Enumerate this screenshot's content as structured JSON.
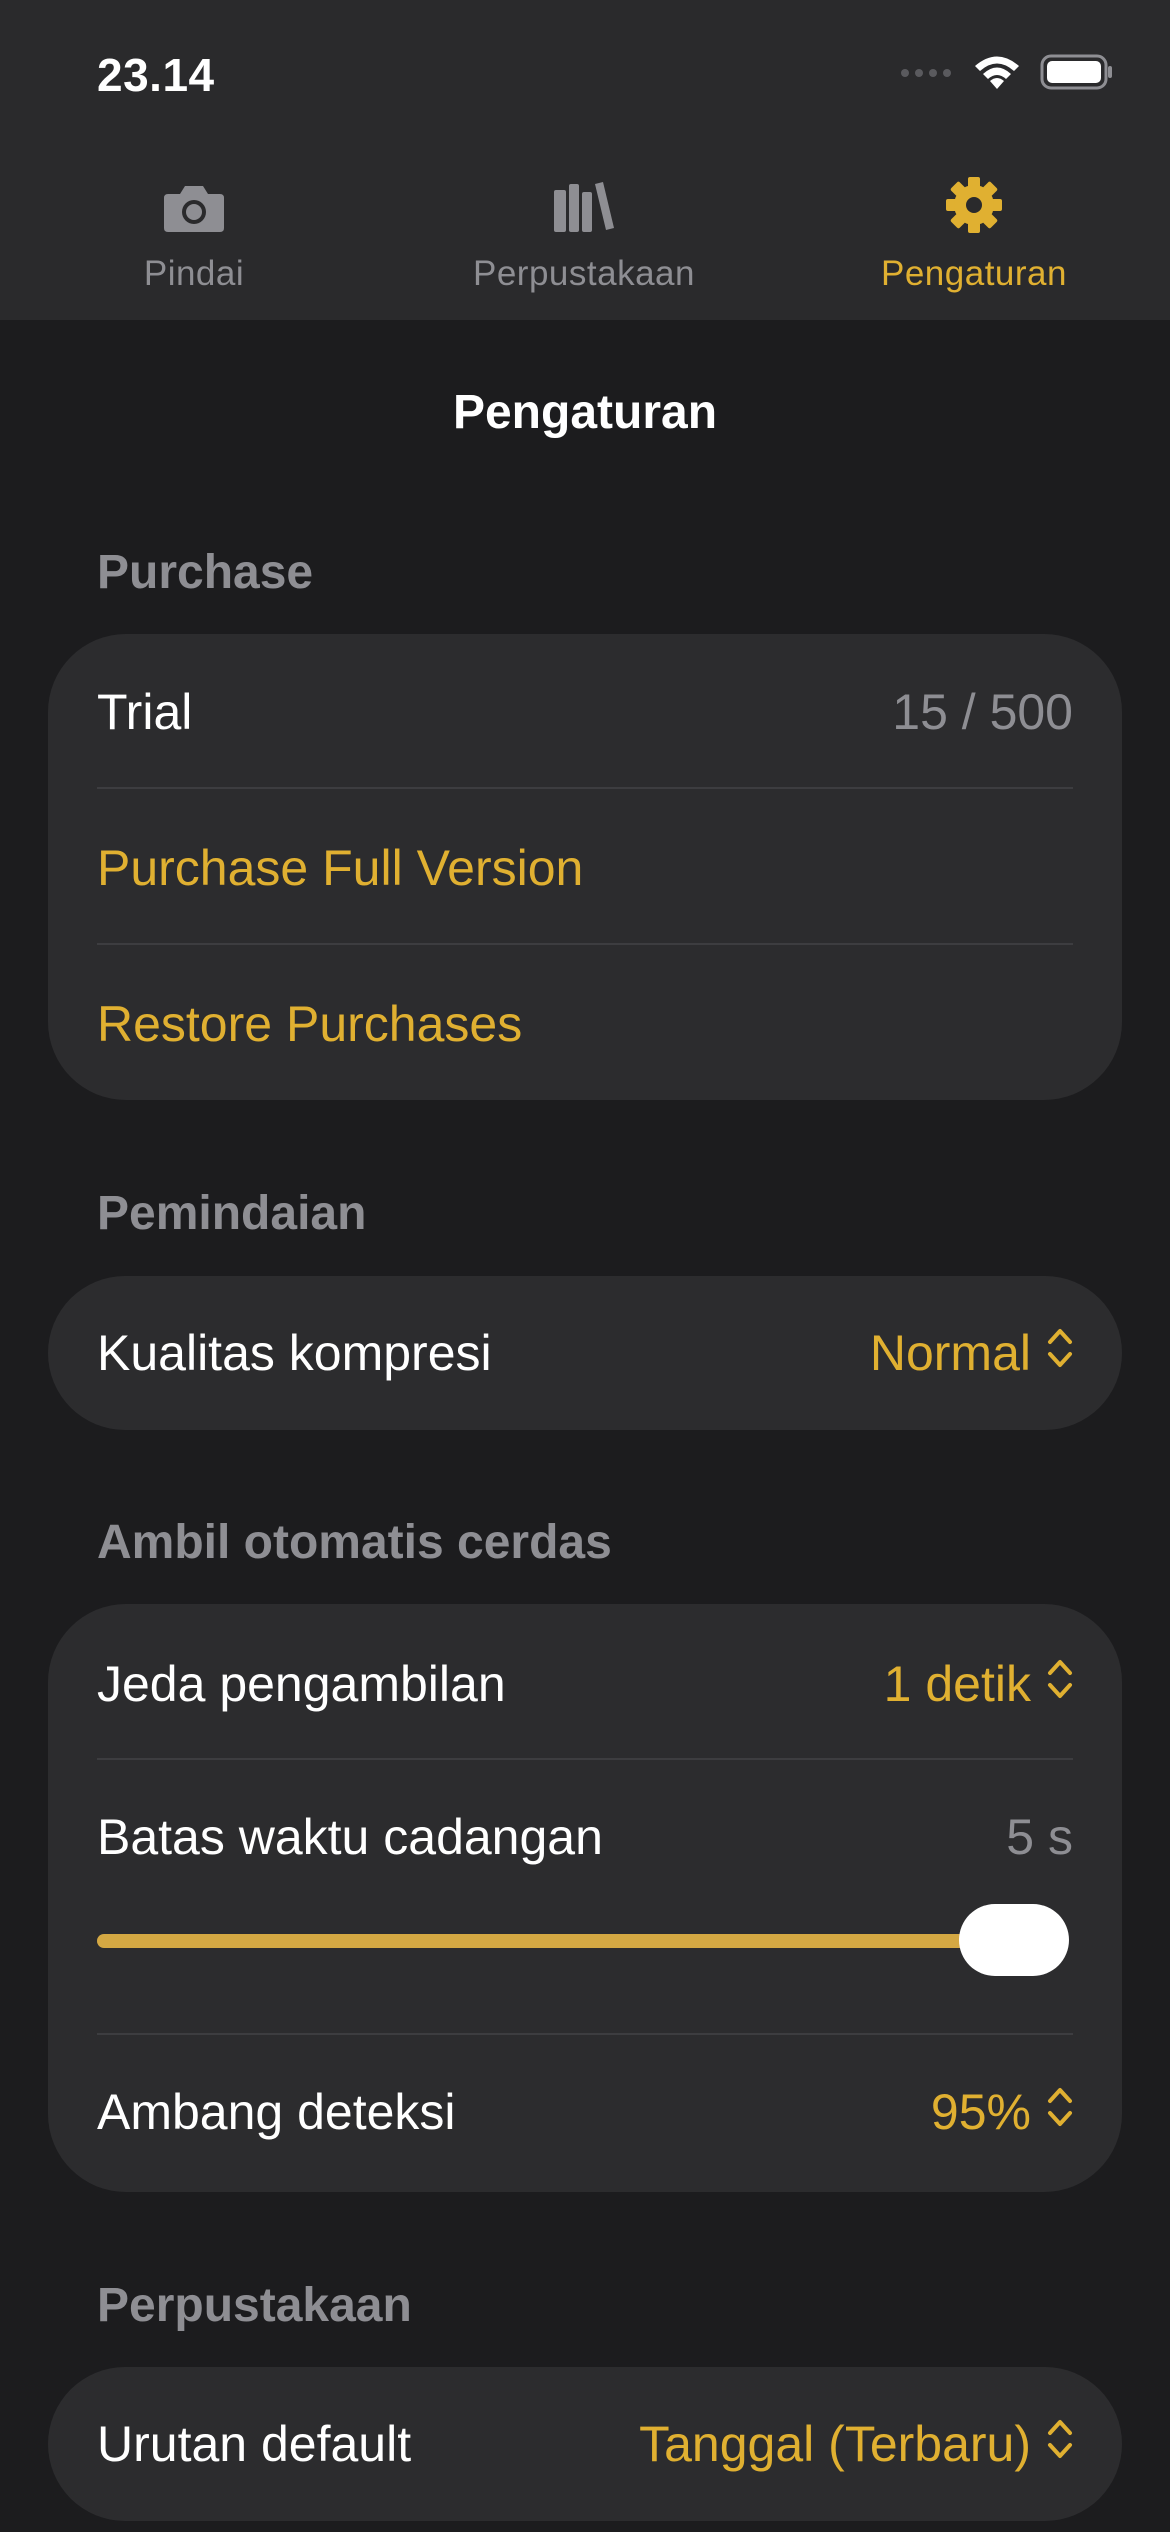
{
  "status_bar": {
    "time": "23.14",
    "icons": [
      "cellular-signal-icon",
      "wifi-icon",
      "battery-icon"
    ]
  },
  "tabs": [
    {
      "label": "Pindai",
      "icon": "camera-icon",
      "active": false
    },
    {
      "label": "Perpustakaan",
      "icon": "library-books-icon",
      "active": false
    },
    {
      "label": "Pengaturan",
      "icon": "gear-icon",
      "active": true
    }
  ],
  "nav": {
    "title": "Pengaturan"
  },
  "sections": {
    "purchase": {
      "header": "Purchase",
      "trial_label": "Trial",
      "trial_value": "15 / 500",
      "purchase_full": "Purchase Full Version",
      "restore": "Restore Purchases"
    },
    "scanning": {
      "header": "Pemindaian",
      "compression_label": "Kualitas kompresi",
      "compression_value": "Normal"
    },
    "smart_capture": {
      "header": "Ambil otomatis cerdas",
      "delay_label": "Jeda pengambilan",
      "delay_value": "1 detik",
      "timeout_label": "Batas waktu cadangan",
      "timeout_value": "5 s",
      "timeout_slider_fraction": 1.0,
      "threshold_label": "Ambang deteksi",
      "threshold_value": "95%"
    },
    "library": {
      "header": "Perpustakaan",
      "sort_label": "Urutan default",
      "sort_value": "Tanggal (Terbaru)"
    }
  },
  "colors": {
    "accent": "#e0b031",
    "background": "#1c1c1e",
    "card": "#2c2c2e",
    "secondary_text": "#8e8e93",
    "slider_fill": "#d4a843"
  }
}
